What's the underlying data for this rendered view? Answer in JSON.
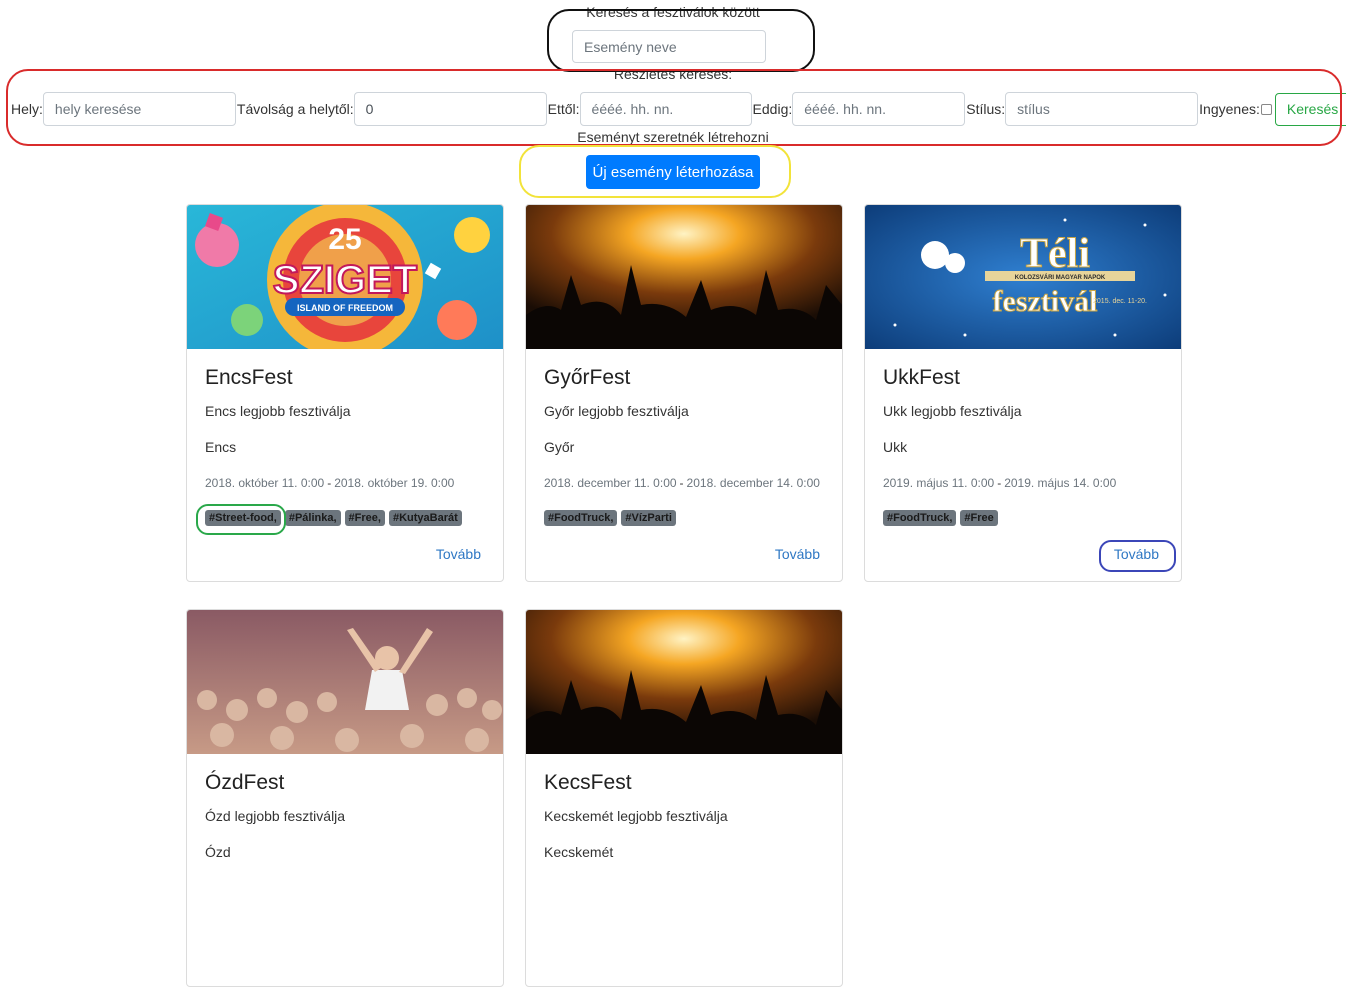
{
  "quick_search": {
    "label": "Keresés a fesztiválok között",
    "placeholder": "Esemény neve"
  },
  "advanced_search": {
    "label": "Részletes keresés:",
    "place_label": "Hely:",
    "place_placeholder": "hely keresése",
    "distance_label": "Távolság a helytől:",
    "distance_value": "0",
    "from_label": "Ettől:",
    "from_placeholder": "éééé. hh. nn.",
    "to_label": "Eddig:",
    "to_placeholder": "éééé. hh. nn.",
    "style_label": "Stílus:",
    "style_placeholder": "stílus",
    "free_label": "Ingyenes:",
    "search_button": "Keresés"
  },
  "create": {
    "label": "Eseményt szeretnék létrehozni",
    "button": "Új esemény léterhozása"
  },
  "cards": [
    {
      "title": "EncsFest",
      "description": "Encs legjobb fesztiválja",
      "place": "Encs",
      "start": "2018. október 11. 0:00",
      "end": "2018. október 19. 0:00",
      "tags": [
        "#Street-food,",
        "#Pálinka,",
        "#Free,",
        "#KutyaBarát"
      ],
      "more": "Tovább",
      "image_text": {
        "number": "25",
        "name": "SZIGET",
        "subtitle": "ISLAND OF FREEDOM"
      }
    },
    {
      "title": "GyőrFest",
      "description": "Győr legjobb fesztiválja",
      "place": "Győr",
      "start": "2018. december 11. 0:00",
      "end": "2018. december 14. 0:00",
      "tags": [
        "#FoodTruck,",
        "#VízParti"
      ],
      "more": "Tovább"
    },
    {
      "title": "UkkFest",
      "description": "Ukk legjobb fesztiválja",
      "place": "Ukk",
      "start": "2019. május 11. 0:00",
      "end": "2019. május 14. 0:00",
      "tags": [
        "#FoodTruck,",
        "#Free"
      ],
      "more": "Tovább",
      "image_text": {
        "title1": "Téli",
        "title2": "fesztivál",
        "band": "KOLOZSVÁRI MAGYAR NAPOK",
        "date": "2015. dec. 11-20."
      }
    },
    {
      "title": "ÓzdFest",
      "description": "Ózd legjobb fesztiválja",
      "place": "Ózd"
    },
    {
      "title": "KecsFest",
      "description": "Kecskemét legjobb fesztiválja",
      "place": "Kecskemét"
    }
  ],
  "date_separator": "-",
  "colors": {
    "primary": "#007bff",
    "success": "#28a745",
    "badge": "#6c757d",
    "link": "#2f78c4"
  }
}
